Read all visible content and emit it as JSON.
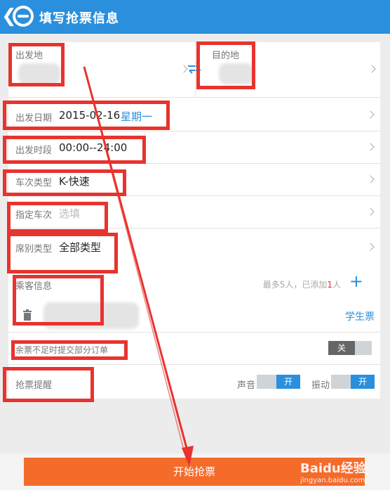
{
  "header": {
    "title": "填写抢票信息"
  },
  "route": {
    "from_label": "出发地",
    "to_label": "目的地"
  },
  "date": {
    "label": "出发日期",
    "value": "2015-02-16",
    "weekday": "星期一"
  },
  "period": {
    "label": "出发时段",
    "value": "00:00--24:00"
  },
  "train_type": {
    "label": "车次类型",
    "value": "K-快速"
  },
  "train_no": {
    "label": "指定车次",
    "placeholder": "选填"
  },
  "seat": {
    "label": "席别类型",
    "value": "全部类型"
  },
  "passenger": {
    "label": "乘客信息",
    "hint_prefix": "最多5人，已添加",
    "count": "1",
    "hint_suffix": "人",
    "student_label": "学生票"
  },
  "partial": {
    "label": "余票不足时提交部分订单",
    "toggle": "关"
  },
  "alert": {
    "label": "抢票提醒",
    "sound_label": "声音",
    "sound_toggle": "开",
    "vibrate_label": "振动",
    "vibrate_toggle": "开"
  },
  "submit": {
    "label": "开始抢票"
  },
  "watermark": {
    "brand": "Baidu经验",
    "url": "jingyan.baidu.com"
  },
  "colors": {
    "accent": "#2a8fdc",
    "button": "#f56b2a",
    "annotation": "#e8332e"
  }
}
